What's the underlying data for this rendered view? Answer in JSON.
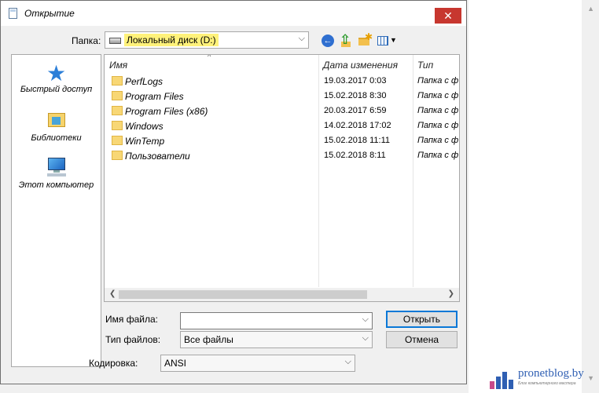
{
  "window": {
    "title": "Открытие",
    "close_glyph": "✕"
  },
  "folder_row": {
    "label": "Папка:",
    "current": "Локальный диск (D:)"
  },
  "toolbar": [
    "back-icon",
    "up-folder-icon",
    "new-folder-icon",
    "views-menu-icon"
  ],
  "places": [
    {
      "label": "Быстрый доступ",
      "icon": "star-icon"
    },
    {
      "label": "Библиотеки",
      "icon": "libraries-icon"
    },
    {
      "label": "Этот компьютер",
      "icon": "computer-icon"
    }
  ],
  "list": {
    "columns": {
      "name": "Имя",
      "date": "Дата изменения",
      "type": "Тип"
    },
    "rows": [
      {
        "name": "PerfLogs",
        "date": "19.03.2017 0:03",
        "type": "Папка с ф"
      },
      {
        "name": "Program Files",
        "date": "15.02.2018 8:30",
        "type": "Папка с ф"
      },
      {
        "name": "Program Files (x86)",
        "date": "20.03.2017 6:59",
        "type": "Папка с ф"
      },
      {
        "name": "Windows",
        "date": "14.02.2018 17:02",
        "type": "Папка с ф"
      },
      {
        "name": "WinTemp",
        "date": "15.02.2018 11:11",
        "type": "Папка с ф"
      },
      {
        "name": "Пользователи",
        "date": "15.02.2018 8:11",
        "type": "Папка с ф"
      }
    ]
  },
  "form": {
    "filename_label": "Имя файла:",
    "filename_value": "",
    "filetype_label": "Тип файлов:",
    "filetype_value": "Все файлы",
    "encoding_label": "Кодировка:",
    "encoding_value": "ANSI",
    "open_button": "Открыть",
    "cancel_button": "Отмена"
  },
  "watermark": {
    "text": "pronetblog.by",
    "subtext": "Блог компьютерного мастера"
  },
  "colors": {
    "accent": "#0a78d7",
    "close": "#c7372f",
    "folder": "#f8d775",
    "highlight": "#fff27a"
  }
}
